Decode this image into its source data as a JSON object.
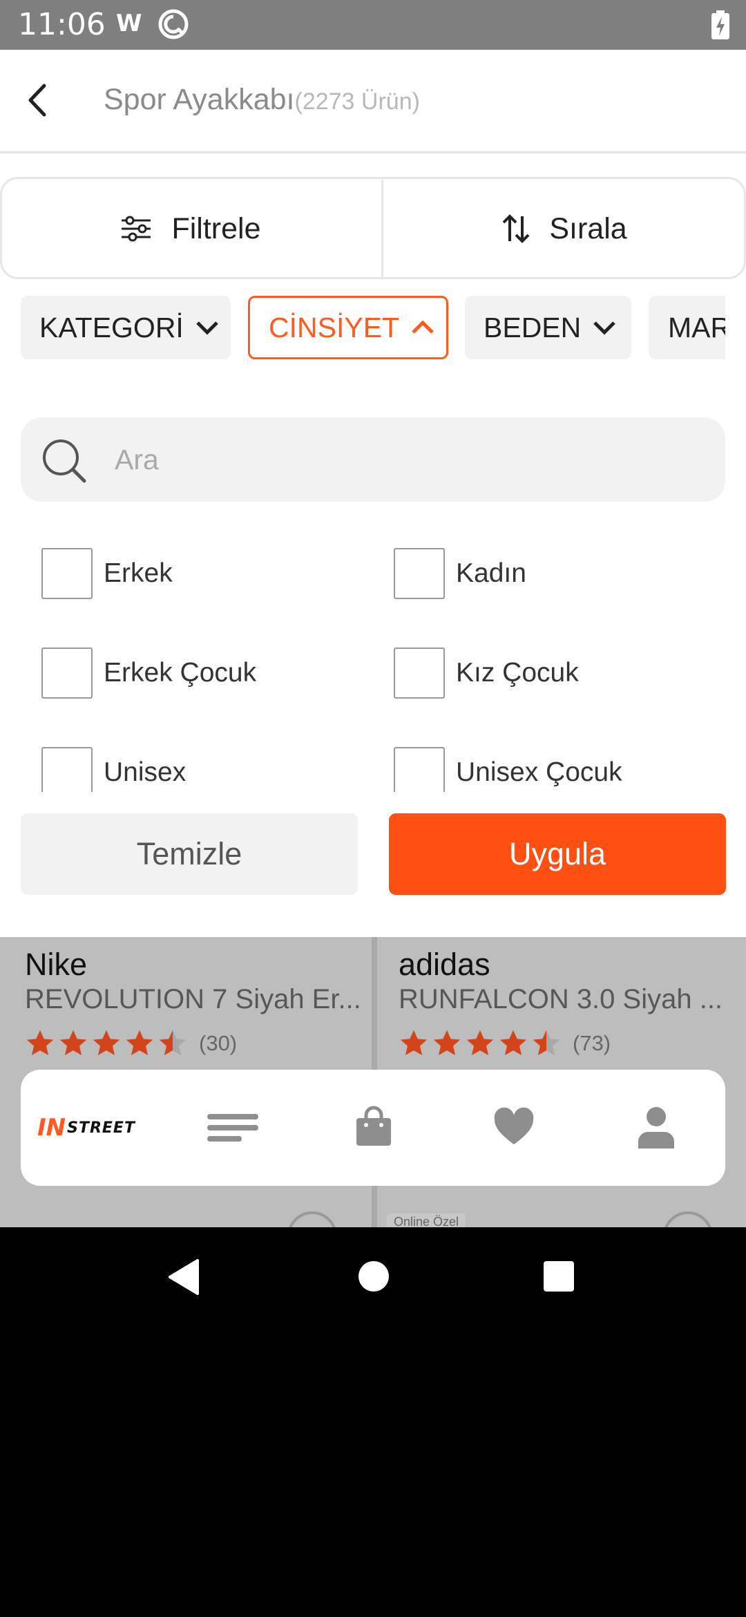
{
  "status_bar": {
    "time": "11:06",
    "w_icon": "W"
  },
  "header": {
    "title": "Spor Ayakkabı",
    "count": "(2273 Ürün)"
  },
  "toolbar": {
    "filter_label": "Filtrele",
    "sort_label": "Sırala"
  },
  "chips": [
    {
      "label": "KATEGORİ",
      "active": false
    },
    {
      "label": "CİNSİYET",
      "active": true
    },
    {
      "label": "BEDEN",
      "active": false
    },
    {
      "label": "MARKA",
      "active": false
    }
  ],
  "search": {
    "placeholder": "Ara",
    "value": ""
  },
  "options": [
    {
      "label": "Erkek",
      "checked": false
    },
    {
      "label": "Kadın",
      "checked": false
    },
    {
      "label": "Erkek Çocuk",
      "checked": false
    },
    {
      "label": "Kız Çocuk",
      "checked": false
    },
    {
      "label": "Unisex",
      "checked": false
    },
    {
      "label": "Unisex Çocuk",
      "checked": false
    }
  ],
  "actions": {
    "clear_label": "Temizle",
    "apply_label": "Uygula"
  },
  "products": [
    {
      "brand": "Nike",
      "name": "REVOLUTION 7 Siyah Er...",
      "rating": 4.5,
      "reviews": "(30)"
    },
    {
      "brand": "adidas",
      "name": "RUNFALCON 3.0 Siyah ...",
      "rating": 4.5,
      "reviews": "(73)"
    }
  ],
  "product_badge": "Online Özel",
  "bottom_nav": {
    "logo_in": "IN",
    "logo_street": "STREET",
    "icons": [
      "menu-icon",
      "shopping-bag-icon",
      "heart-icon",
      "user-icon"
    ]
  },
  "colors": {
    "accent": "#ff5014",
    "star": "#d2451b"
  }
}
